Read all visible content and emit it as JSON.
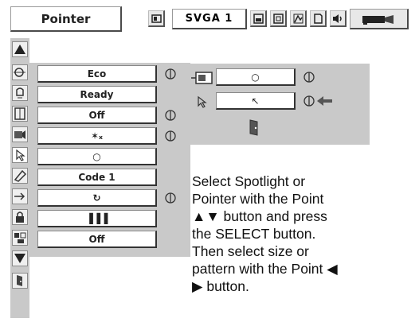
{
  "header": {
    "title": "Pointer",
    "input_source": "SVGA 1",
    "toolbar_icons": [
      "screen-icon",
      "picture-icon",
      "settings-icon",
      "page-icon",
      "sound-icon",
      "projector-icon"
    ]
  },
  "sidebar_icons": [
    "scroll-up-arrow-icon",
    "eco-lamp-icon",
    "standby-icon",
    "fan-icon",
    "projector-lamp-icon",
    "pointer-icon",
    "remote-code-icon",
    "filter-icon",
    "lock-icon",
    "keypad-icon",
    "scroll-down-arrow-icon",
    "exit-icon"
  ],
  "settings": [
    {
      "label": "Eco",
      "cycle": true
    },
    {
      "label": "Ready",
      "cycle": false
    },
    {
      "label": "Off",
      "cycle": true
    },
    {
      "label": "✶ₓ",
      "cycle": true
    },
    {
      "label": "○",
      "cycle": false
    },
    {
      "label": "Code 1",
      "cycle": false
    },
    {
      "label": "↻",
      "cycle": true
    },
    {
      "label": "▐▐▐",
      "cycle": false
    },
    {
      "label": "Off",
      "cycle": false
    }
  ],
  "submenu": {
    "spotlight_value": "○",
    "pointer_value": "↖"
  },
  "description": {
    "line1": "Select Spotlight or",
    "line2": "Pointer with the Point",
    "line3_arrows": "▲▼",
    "line3_text": " button and press",
    "line4": "the SELECT button.",
    "line5": "Then select size or",
    "line6_text": "pattern with the Point ",
    "line6_arrow": "◀",
    "line7_arrow": "▶",
    "line7_text": " button."
  },
  "colors": {
    "panel_gray": "#c9c9c9",
    "dark_border": "#333333",
    "text": "#222222"
  }
}
